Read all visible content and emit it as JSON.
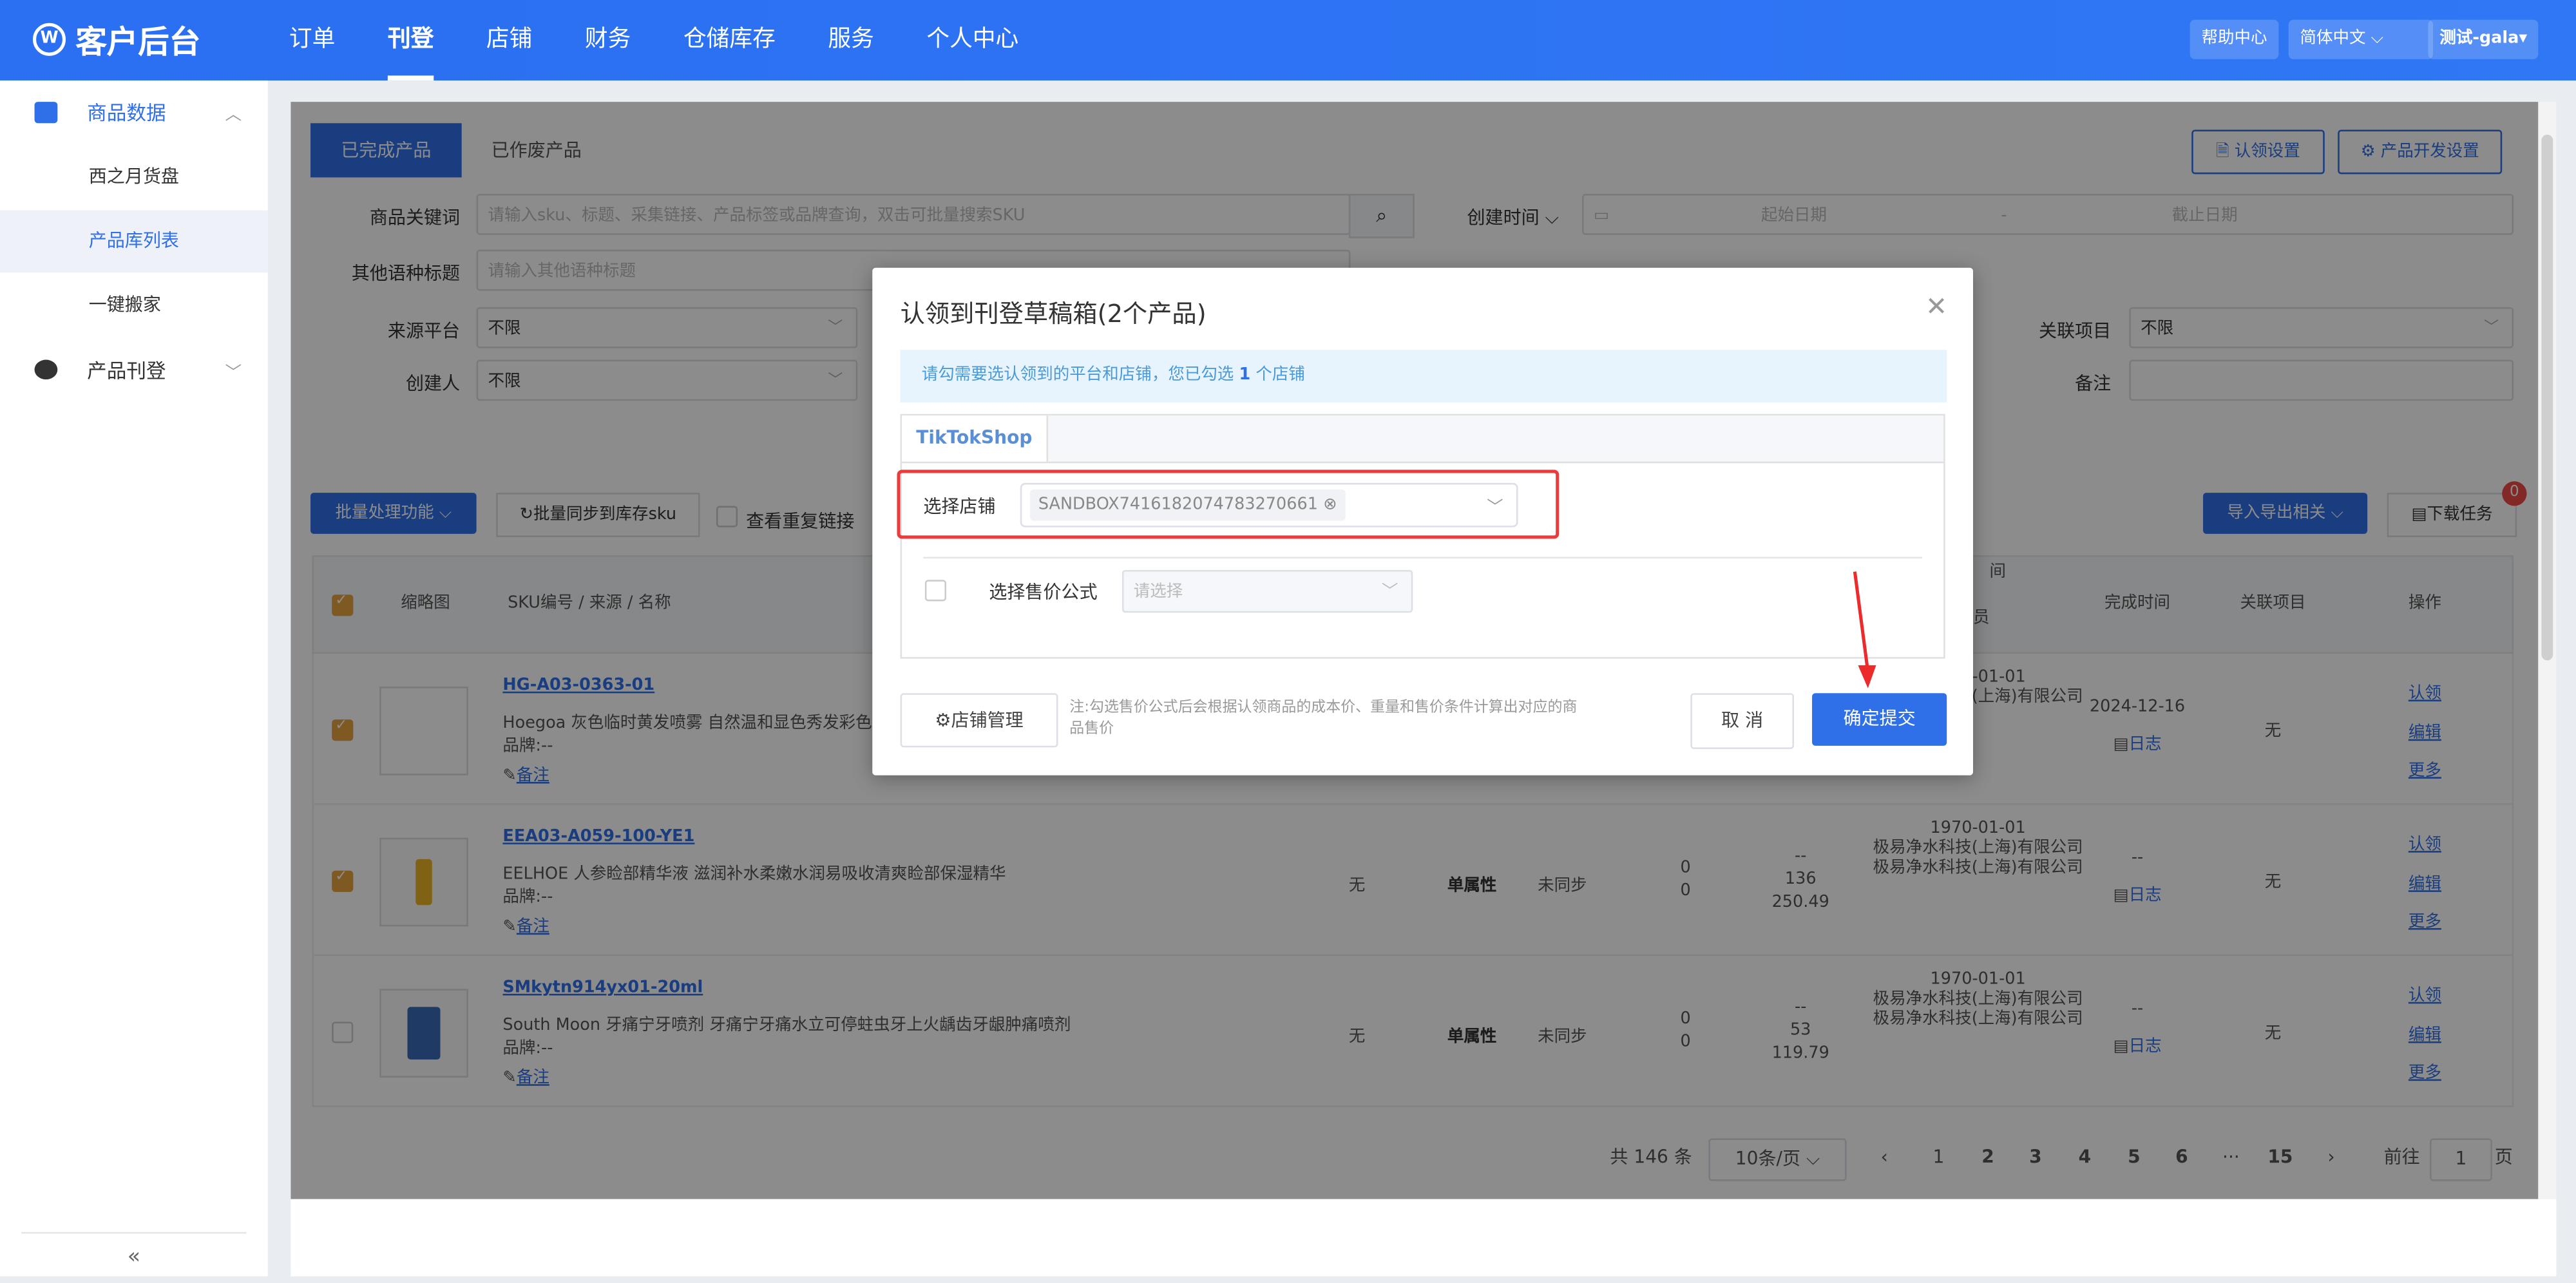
{
  "app": {
    "logo_text": "客户后台",
    "logo_mark": "W"
  },
  "nav": {
    "items": [
      "订单",
      "刊登",
      "店铺",
      "财务",
      "仓储库存",
      "服务",
      "个人中心"
    ],
    "help": "帮助中心",
    "language": "简体中文",
    "user": "测试-gala"
  },
  "sidebar": {
    "group1": {
      "label": "商品数据",
      "icon": "chart-icon"
    },
    "subs": [
      "西之月货盘",
      "产品库列表",
      "一键搬家"
    ],
    "group2": {
      "label": "产品刊登",
      "icon": "graduation-cap-icon"
    },
    "collapse": "«"
  },
  "page": {
    "tabs": [
      "已完成产品",
      "已作废产品"
    ],
    "claim_settings": "认领设置",
    "dev_settings": "产品开发设置",
    "filters": {
      "keyword_label": "商品关键词",
      "keyword_placeholder": "请输入sku、标题、采集链接、产品标签或品牌查询，双击可批量搜索SKU",
      "other_title_label": "其他语种标题",
      "other_title_placeholder": "请输入其他语种标题",
      "source_label": "来源平台",
      "source_value": "不限",
      "creator_label": "创建人",
      "creator_value": "不限",
      "created_time_label": "创建时间",
      "start_placeholder": "起始日期",
      "date_sep": "-",
      "end_placeholder": "截止日期",
      "project_label": "关联项目",
      "project_value": "不限",
      "remark_label": "备注"
    },
    "toolbar": {
      "batch": "批量处理功能",
      "sync": "批量同步到库存sku",
      "dup": "查看重复链接",
      "import_export": "导入导出相关",
      "download": "下载任务",
      "download_badge": "0"
    },
    "table": {
      "headers": {
        "thumb": "缩略图",
        "sku": "SKU编号 / 来源 / 名称",
        "time_top": "间",
        "developer": "开发员",
        "done": "完成时间",
        "project": "关联项目",
        "ops": "操作"
      },
      "rows": [
        {
          "sku": "HG-A03-0363-01",
          "name": "Hoegoa 灰色临时黄发喷雾 自然温和显色秀发彩色喷",
          "brand": "品牌:--",
          "remark": "备注",
          "date": "1970-01-01",
          "company": "极易净水科技(上海)有限公司",
          "done": "2024-12-16",
          "log": "日志",
          "project": "无",
          "op1": "认领",
          "op2": "编辑",
          "op3": "更多"
        },
        {
          "sku": "EEA03-A059-100-YE1",
          "name": "EELHOE 人参睑部精华液 滋润补水柔嫩水润易吸收清爽睑部保湿精华",
          "brand": "品牌:--",
          "remark": "备注",
          "c1": "无",
          "attr": "单属性",
          "sync": "未同步",
          "n1": "0",
          "n2": "0",
          "p1": "--",
          "p2": "136",
          "p3": "250.49",
          "date": "1970-01-01",
          "company": "极易净水科技(上海)有限公司",
          "done": "--",
          "log": "日志",
          "project": "无",
          "op1": "认领",
          "op2": "编辑",
          "op3": "更多"
        },
        {
          "sku": "SMkytn914yx01-20ml",
          "name": "South Moon 牙痛宁牙喷剂 牙痛宁牙痛水立可停蛀虫牙上火龋齿牙龈肿痛喷剂",
          "brand": "品牌:--",
          "remark": "备注",
          "c1": "无",
          "attr": "单属性",
          "sync": "未同步",
          "n1": "0",
          "n2": "0",
          "p1": "--",
          "p2": "53",
          "p3": "119.79",
          "date": "1970-01-01",
          "company": "极易净水科技(上海)有限公司",
          "done": "--",
          "log": "日志",
          "project": "无",
          "op1": "认领",
          "op2": "编辑",
          "op3": "更多"
        }
      ]
    },
    "pager": {
      "total": "共 146 条",
      "size": "10条/页",
      "pages": [
        "1",
        "2",
        "3",
        "4",
        "5",
        "6",
        "···",
        "15"
      ],
      "goto": "前往",
      "goto_value": "1",
      "page_unit": "页"
    }
  },
  "modal": {
    "title": "认领到刊登草稿箱(2个产品)",
    "tip_before": "请勾需要选认领到的平台和店铺，您已勾选",
    "tip_count": "1",
    "tip_after": "个店铺",
    "platform_tab": "TikTokShop",
    "store_label": "选择店铺",
    "store_tag": "SANDBOX7416182074783270661",
    "formula_label": "选择售价公式",
    "formula_placeholder": "请选择",
    "shop_manage": "店铺管理",
    "note": "注:勾选售价公式后会根据认领商品的成本价、重量和售价条件计算出对应的商品售价",
    "cancel": "取 消",
    "confirm": "确定提交"
  },
  "colors": {
    "primary": "#2f6fe8",
    "highlight": "#ec3b3b",
    "checkbox": "#e6a23c"
  }
}
